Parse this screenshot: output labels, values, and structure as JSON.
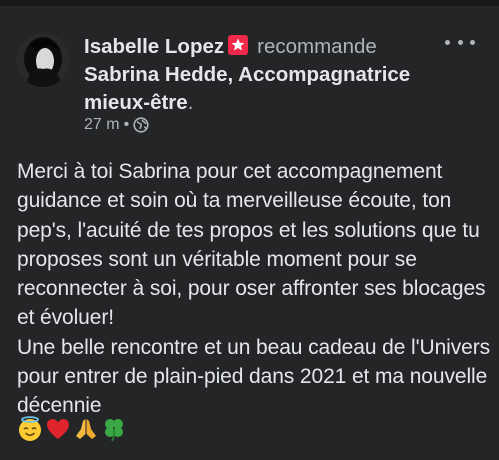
{
  "post": {
    "author": "Isabelle Lopez",
    "verb": "recommande",
    "page_name": "Sabrina Hedde, Accompagnatrice mieux-être",
    "period": ".",
    "time": "27 m",
    "separator": "•",
    "audience_icon": "globe-icon",
    "badge_icon": "star-badge-icon",
    "more_icon": "more-options-icon",
    "paragraphs": [
      "Merci à toi Sabrina pour cet accompagnement guidance et soin où ta merveilleuse écoute, ton pep's, l'acuité de tes propos et les solutions que tu proposes sont un véritable moment pour se reconnecter à soi, pour oser affronter ses blocages et évoluer!",
      "Une belle rencontre et un beau cadeau de l'Univers pour entrer de plain-pied dans 2021 et ma nouvelle décennie"
    ],
    "emojis": [
      "smiling-face-with-halo-icon",
      "red-heart-icon",
      "folded-hands-icon",
      "four-leaf-clover-icon"
    ]
  },
  "colors": {
    "background": "#242526",
    "primary_text": "#e4e6eb",
    "secondary_text": "#b0b3b8",
    "badge": "#f02849"
  }
}
